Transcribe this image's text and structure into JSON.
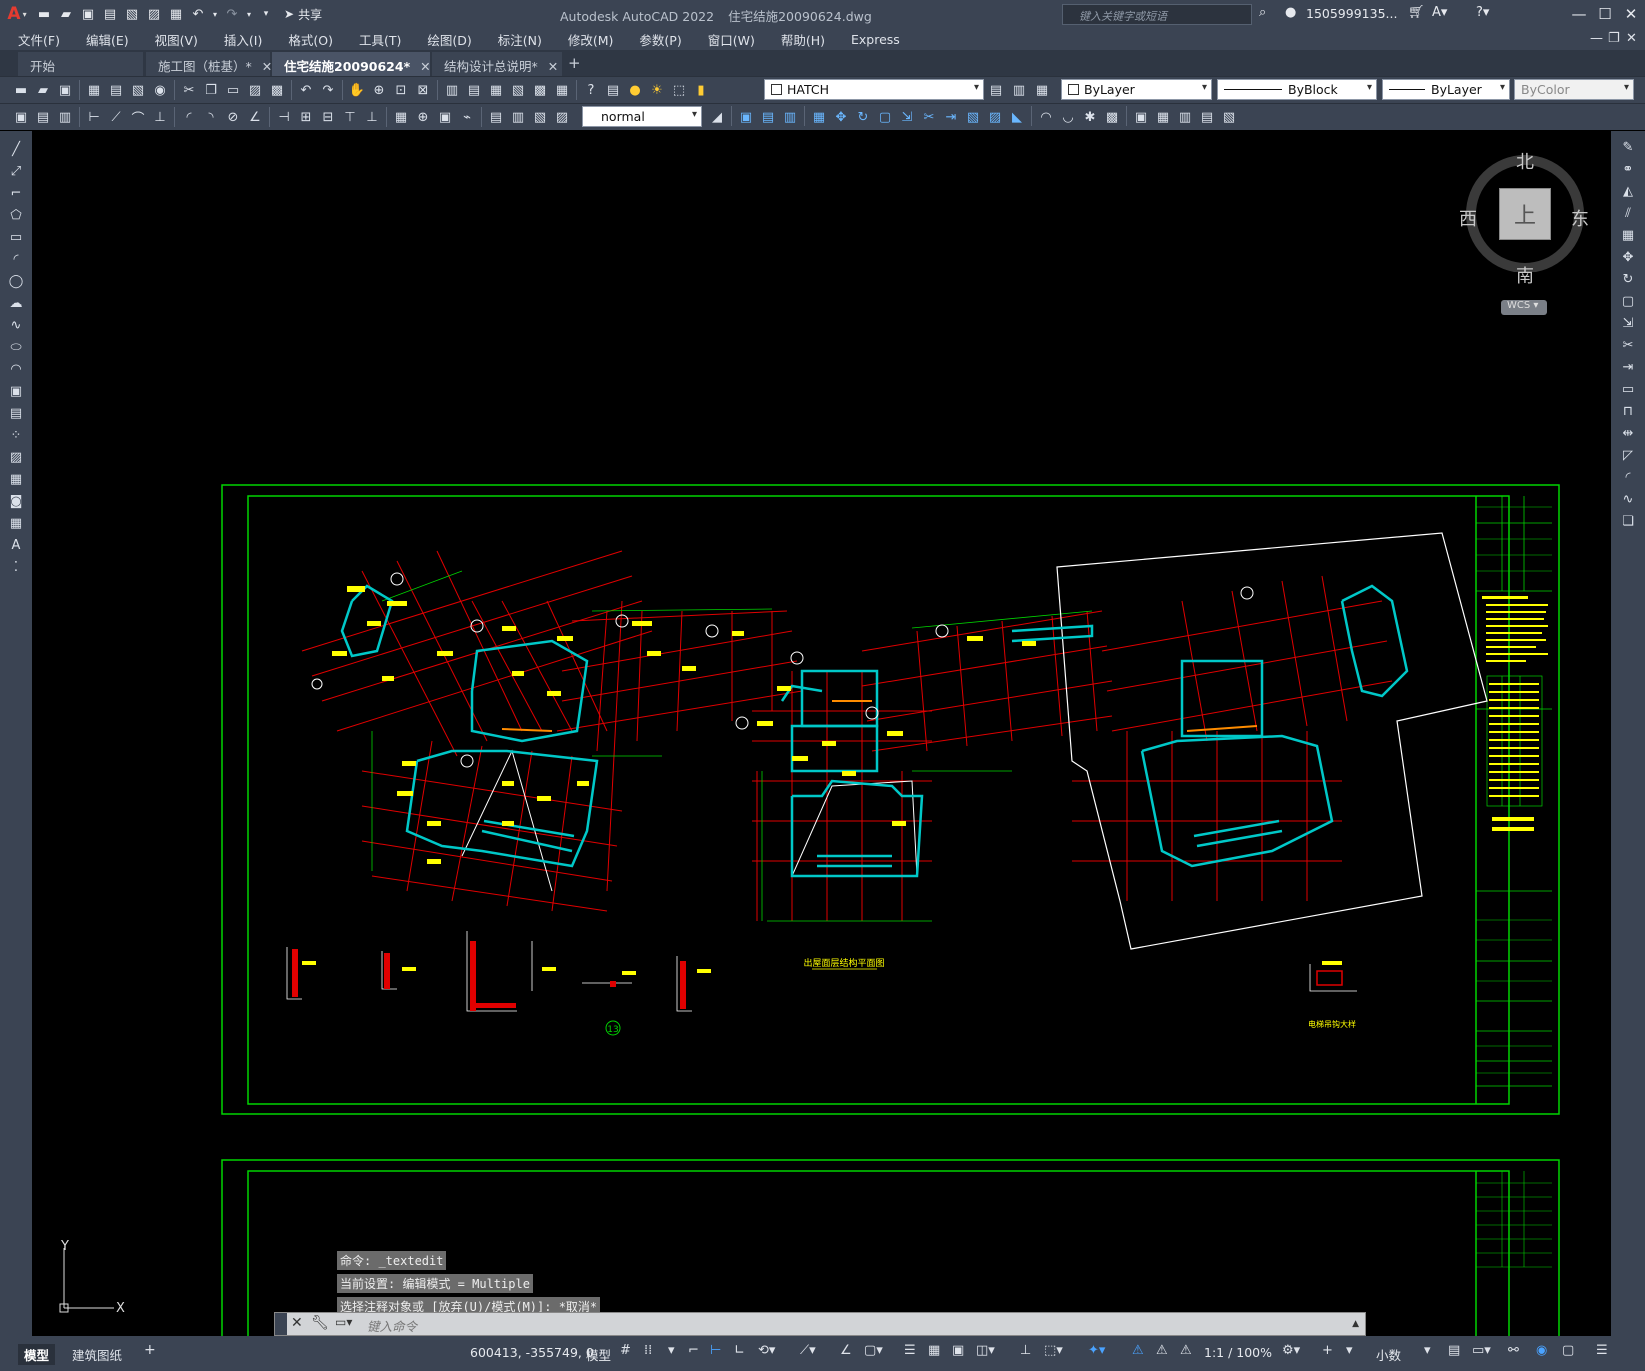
{
  "app": {
    "logo": "A",
    "title": "Autodesk AutoCAD 2022",
    "filename": "住宅结施20090624.dwg",
    "share_label": "共享",
    "search_placeholder": "键入关键字或短语",
    "user": "1505999135...",
    "help_icon": "help-icon"
  },
  "menu": [
    "文件(F)",
    "编辑(E)",
    "视图(V)",
    "插入(I)",
    "格式(O)",
    "工具(T)",
    "绘图(D)",
    "标注(N)",
    "修改(M)",
    "参数(P)",
    "窗口(W)",
    "帮助(H)",
    "Express"
  ],
  "tabs": [
    {
      "label": "开始",
      "closable": false,
      "active": false
    },
    {
      "label": "施工图（桩基）*",
      "closable": true,
      "active": false
    },
    {
      "label": "住宅结施20090624*",
      "closable": true,
      "active": true
    },
    {
      "label": "结构设计总说明*",
      "closable": true,
      "active": false
    }
  ],
  "properties": {
    "layer": "HATCH",
    "color": "ByLayer",
    "linetype": "ByBlock",
    "lineweight": "ByLayer",
    "plotstyle": "ByColor",
    "dimstyle": "normal"
  },
  "viewcube": {
    "north": "北",
    "south": "南",
    "east": "东",
    "west": "西",
    "top": "上",
    "wcs": "WCS"
  },
  "drawing": {
    "sheet_number": "13",
    "plan_title": "出屋面层结构平面图",
    "detail_title": "电梯吊钩大样",
    "colors": {
      "frame": "#00d400",
      "grid": "#e00000",
      "wall": "#00c8c8",
      "text": "#ffff00",
      "outline": "#ffffff"
    }
  },
  "ucs": {
    "x": "X",
    "y": "Y"
  },
  "command": {
    "history": [
      "命令: _textedit",
      "当前设置: 编辑模式 = Multiple",
      "选择注释对象或 [放弃(U)/模式(M)]: *取消*"
    ],
    "placeholder": "键入命令"
  },
  "layouts": [
    {
      "label": "模型",
      "active": true
    },
    {
      "label": "建筑图纸",
      "active": false
    }
  ],
  "status": {
    "coordinates": "600413, -355749, 0",
    "space": "模型",
    "scale": "1:1 / 100%",
    "units": "小数"
  }
}
